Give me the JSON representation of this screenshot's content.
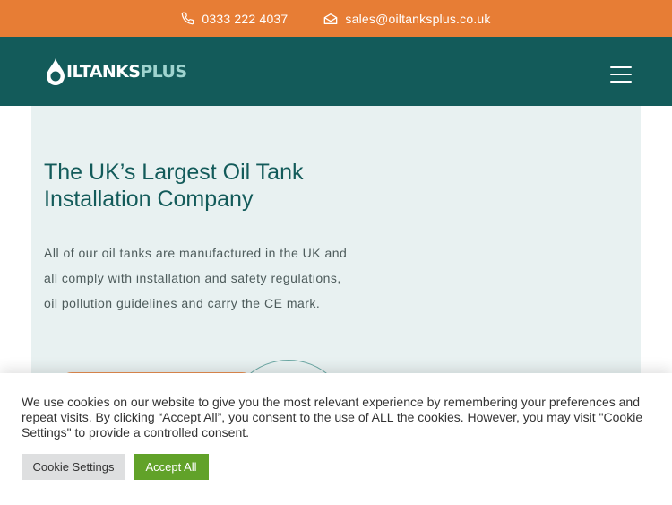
{
  "topbar": {
    "phone": "0333 222 4037",
    "email": "sales@oiltanksplus.co.uk",
    "bg_color": "#e77d35"
  },
  "header": {
    "logo_part1": "ILTANKS",
    "logo_part2": "PLUS",
    "bg_color": "#135b5a",
    "menu_icon": "hamburger-menu-icon"
  },
  "hero": {
    "title": "The UK’s Largest Oil Tank Installation Company",
    "body": "All of our oil tanks are manufactured in the UK and all comply with installation and safety regulations, oil pollution guidelines and carry the CE mark.",
    "bg_color": "#e8f1f1"
  },
  "cookie": {
    "message": "We use cookies on our website to give you the most relevant experience by remembering your preferences and repeat visits. By clicking “Accept All”, you consent to the use of ALL the cookies. However, you may visit \"Cookie Settings\" to provide a controlled consent.",
    "settings_label": "Cookie Settings",
    "accept_label": "Accept All",
    "accept_color": "#61a229"
  }
}
